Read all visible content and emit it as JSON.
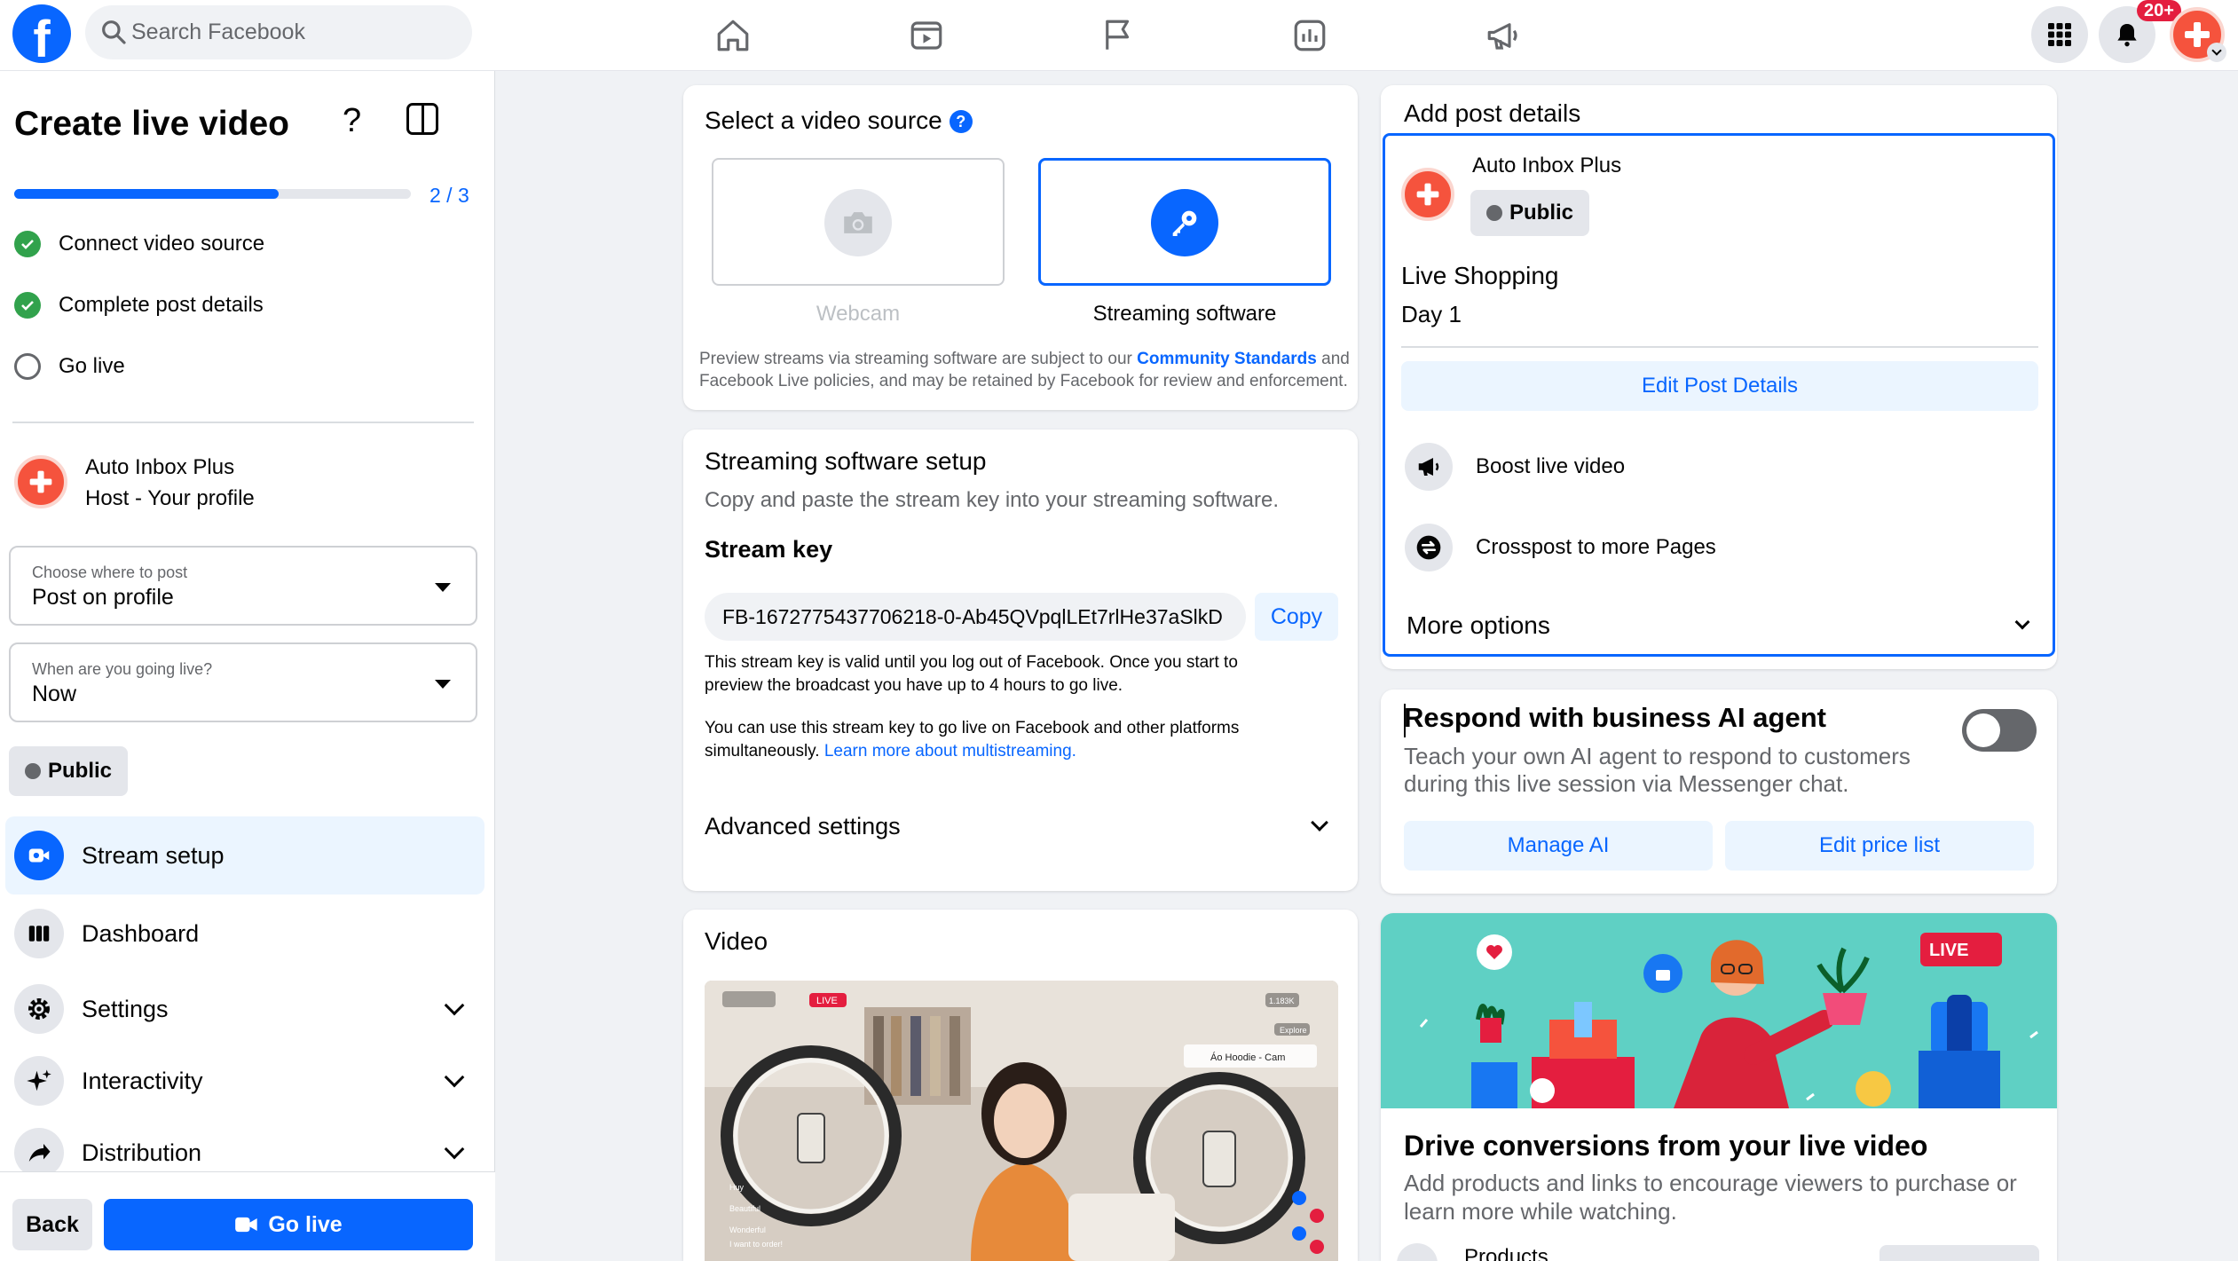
{
  "topbar": {
    "logo": "f",
    "search_placeholder": "Search Facebook",
    "notifications_badge": "20+",
    "nav_icons": [
      "home-icon",
      "video-icon",
      "flag-icon",
      "chart-icon",
      "megaphone-icon"
    ]
  },
  "sidebar": {
    "title": "Create live video",
    "progress_label": "2 / 3",
    "progress_fraction": 0.6667,
    "steps": [
      {
        "label": "Connect video source",
        "done": true
      },
      {
        "label": "Complete post details",
        "done": true
      },
      {
        "label": "Go live",
        "done": false
      }
    ],
    "host": {
      "name": "Auto Inbox Plus",
      "role": "Host - Your profile"
    },
    "post_where": {
      "label": "Choose where to post",
      "value": "Post on profile"
    },
    "when_live": {
      "label": "When are you going live?",
      "value": "Now"
    },
    "audience": "Public",
    "menu": [
      {
        "label": "Stream setup",
        "icon": "camera-icon",
        "active": true
      },
      {
        "label": "Dashboard",
        "icon": "dashboard-icon",
        "active": false
      },
      {
        "label": "Settings",
        "icon": "gear-icon",
        "active": false
      },
      {
        "label": "Interactivity",
        "icon": "sparkle-icon",
        "active": false
      },
      {
        "label": "Distribution",
        "icon": "share-icon",
        "active": false
      }
    ],
    "back_label": "Back",
    "go_live_label": "Go live"
  },
  "video_source": {
    "title": "Select a video source",
    "options": [
      {
        "label": "Webcam",
        "selected": false
      },
      {
        "label": "Streaming software",
        "selected": true
      }
    ],
    "notice_pre": "Preview streams via streaming software are subject to our ",
    "notice_link": "Community Standards",
    "notice_mid": " and",
    "notice_line2": "Facebook Live policies, and may be retained by Facebook for review and enforcement."
  },
  "streaming_setup": {
    "title": "Streaming software setup",
    "subtitle": "Copy and paste the stream key into your streaming software.",
    "key_label": "Stream key",
    "key_value": "FB-1672775437706218-0-Ab45QVpqlLEt7rlHe37aSlkD",
    "copy_label": "Copy",
    "validity_line1": "This stream key is valid until you log out of Facebook. Once you start to",
    "validity_line2": "preview the broadcast you have up to 4 hours to go live.",
    "multi_line1": "You can use this stream key to go live on Facebook and other platforms",
    "multi_line2_pre": "simultaneously. ",
    "multi_link": "Learn more about multistreaming.",
    "advanced_label": "Advanced settings"
  },
  "video_card": {
    "title": "Video",
    "live_tag": "LIVE",
    "viewers": "1.183K",
    "explore": "Explore",
    "product_tag": "Áo Hoodie - Cam",
    "comments": [
      "Huy",
      "Beautiful",
      "Wonderful",
      "I want to order!"
    ]
  },
  "post_details": {
    "title": "Add post details",
    "page_name": "Auto Inbox Plus",
    "audience": "Public",
    "post_title": "Live Shopping",
    "post_desc": "Day 1",
    "edit_label": "Edit Post Details",
    "options": [
      {
        "label": "Boost live video",
        "icon": "megaphone-icon"
      },
      {
        "label": "Crosspost to more Pages",
        "icon": "crosspost-icon"
      }
    ],
    "more_label": "More options"
  },
  "ai_agent": {
    "title": "Respond with business AI agent",
    "desc_line1": "Teach your own AI agent to respond to customers",
    "desc_line2": "during this live session via Messenger chat.",
    "toggle_on": false,
    "manage_label": "Manage AI",
    "price_label": "Edit price list"
  },
  "conversions": {
    "live_badge": "LIVE",
    "title": "Drive conversions from your live video",
    "desc_line1": "Add products and links to encourage viewers to purchase or",
    "desc_line2": "learn more while watching.",
    "products_label": "Products"
  },
  "colors": {
    "brand_blue": "#0866ff",
    "light_blue": "#ebf5ff",
    "success_green": "#31a24c",
    "accent_orange": "#f5533d",
    "illustration_teal": "#5fd0c4"
  }
}
